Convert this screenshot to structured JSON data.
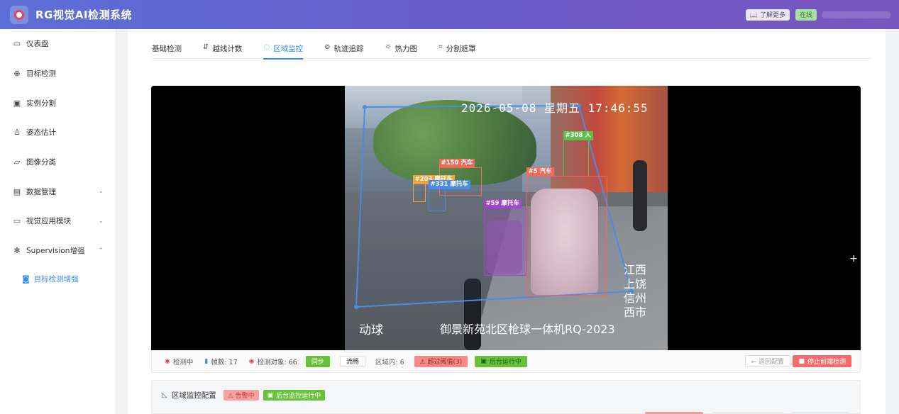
{
  "header": {
    "title": "RG视觉AI检测系统",
    "learn_more": "📖 了解更多",
    "status": "在线"
  },
  "sidebar": {
    "items": [
      {
        "label": "仪表盘",
        "icon": "monitor-icon"
      },
      {
        "label": "目标检测",
        "icon": "crosshair-icon"
      },
      {
        "label": "实例分割",
        "icon": "image-icon"
      },
      {
        "label": "姿态估计",
        "icon": "user-icon"
      },
      {
        "label": "图像分类",
        "icon": "folder-icon"
      },
      {
        "label": "数据管理",
        "icon": "box-icon"
      },
      {
        "label": "视觉应用模块",
        "icon": "monitor-icon"
      },
      {
        "label": "Supervision增强",
        "icon": "sparkle-icon"
      }
    ],
    "sub_item": "目标检测增强"
  },
  "tabs": [
    {
      "label": "基础检测",
      "icon": ""
    },
    {
      "label": "越线计数",
      "icon": "⇵"
    },
    {
      "label": "区域监控",
      "icon": "◌"
    },
    {
      "label": "轨迹追踪",
      "icon": "⊚"
    },
    {
      "label": "热力图",
      "icon": "☼"
    },
    {
      "label": "分割遮罩",
      "icon": "⌗"
    }
  ],
  "video": {
    "timestamp": "2026-05-08 星期五 17:46:55",
    "osd_left": "动球",
    "osd_center": "御景新苑北区枪球一体机RQ-2023",
    "osd_vertical": "江西上饶信州西市",
    "detections": [
      {
        "label": "#308 人",
        "color": "#5fbf4a"
      },
      {
        "label": "#150 汽车",
        "color": "#f06a5a"
      },
      {
        "label": "#203 摩托车",
        "color": "#f0a33a"
      },
      {
        "label": "#331 摩托车",
        "color": "#4a8be6"
      },
      {
        "label": "#5 汽车",
        "color": "#f06a5a"
      },
      {
        "label": "#59 摩托车",
        "color": "#a047c8"
      }
    ]
  },
  "status_bar": {
    "detecting": "检测中",
    "frames": "帧数: 17",
    "objects": "检测对象: 66",
    "sync": "同步",
    "smooth": "流畅",
    "in_zone": "区域内: 6",
    "over_threshold": "⚠ 超过阈值(3)",
    "background": "后台运行中",
    "back_config": "← 返回配置",
    "stop": "停止前端检测"
  },
  "config": {
    "title": "区域监控配置",
    "alarm": "⚠ 告警中",
    "monitoring": "后台监控运行中"
  },
  "colors": {
    "accent": "#3a8ee6",
    "zone": "#4a8be6",
    "success": "#67c23a",
    "danger": "#f56c6c"
  }
}
